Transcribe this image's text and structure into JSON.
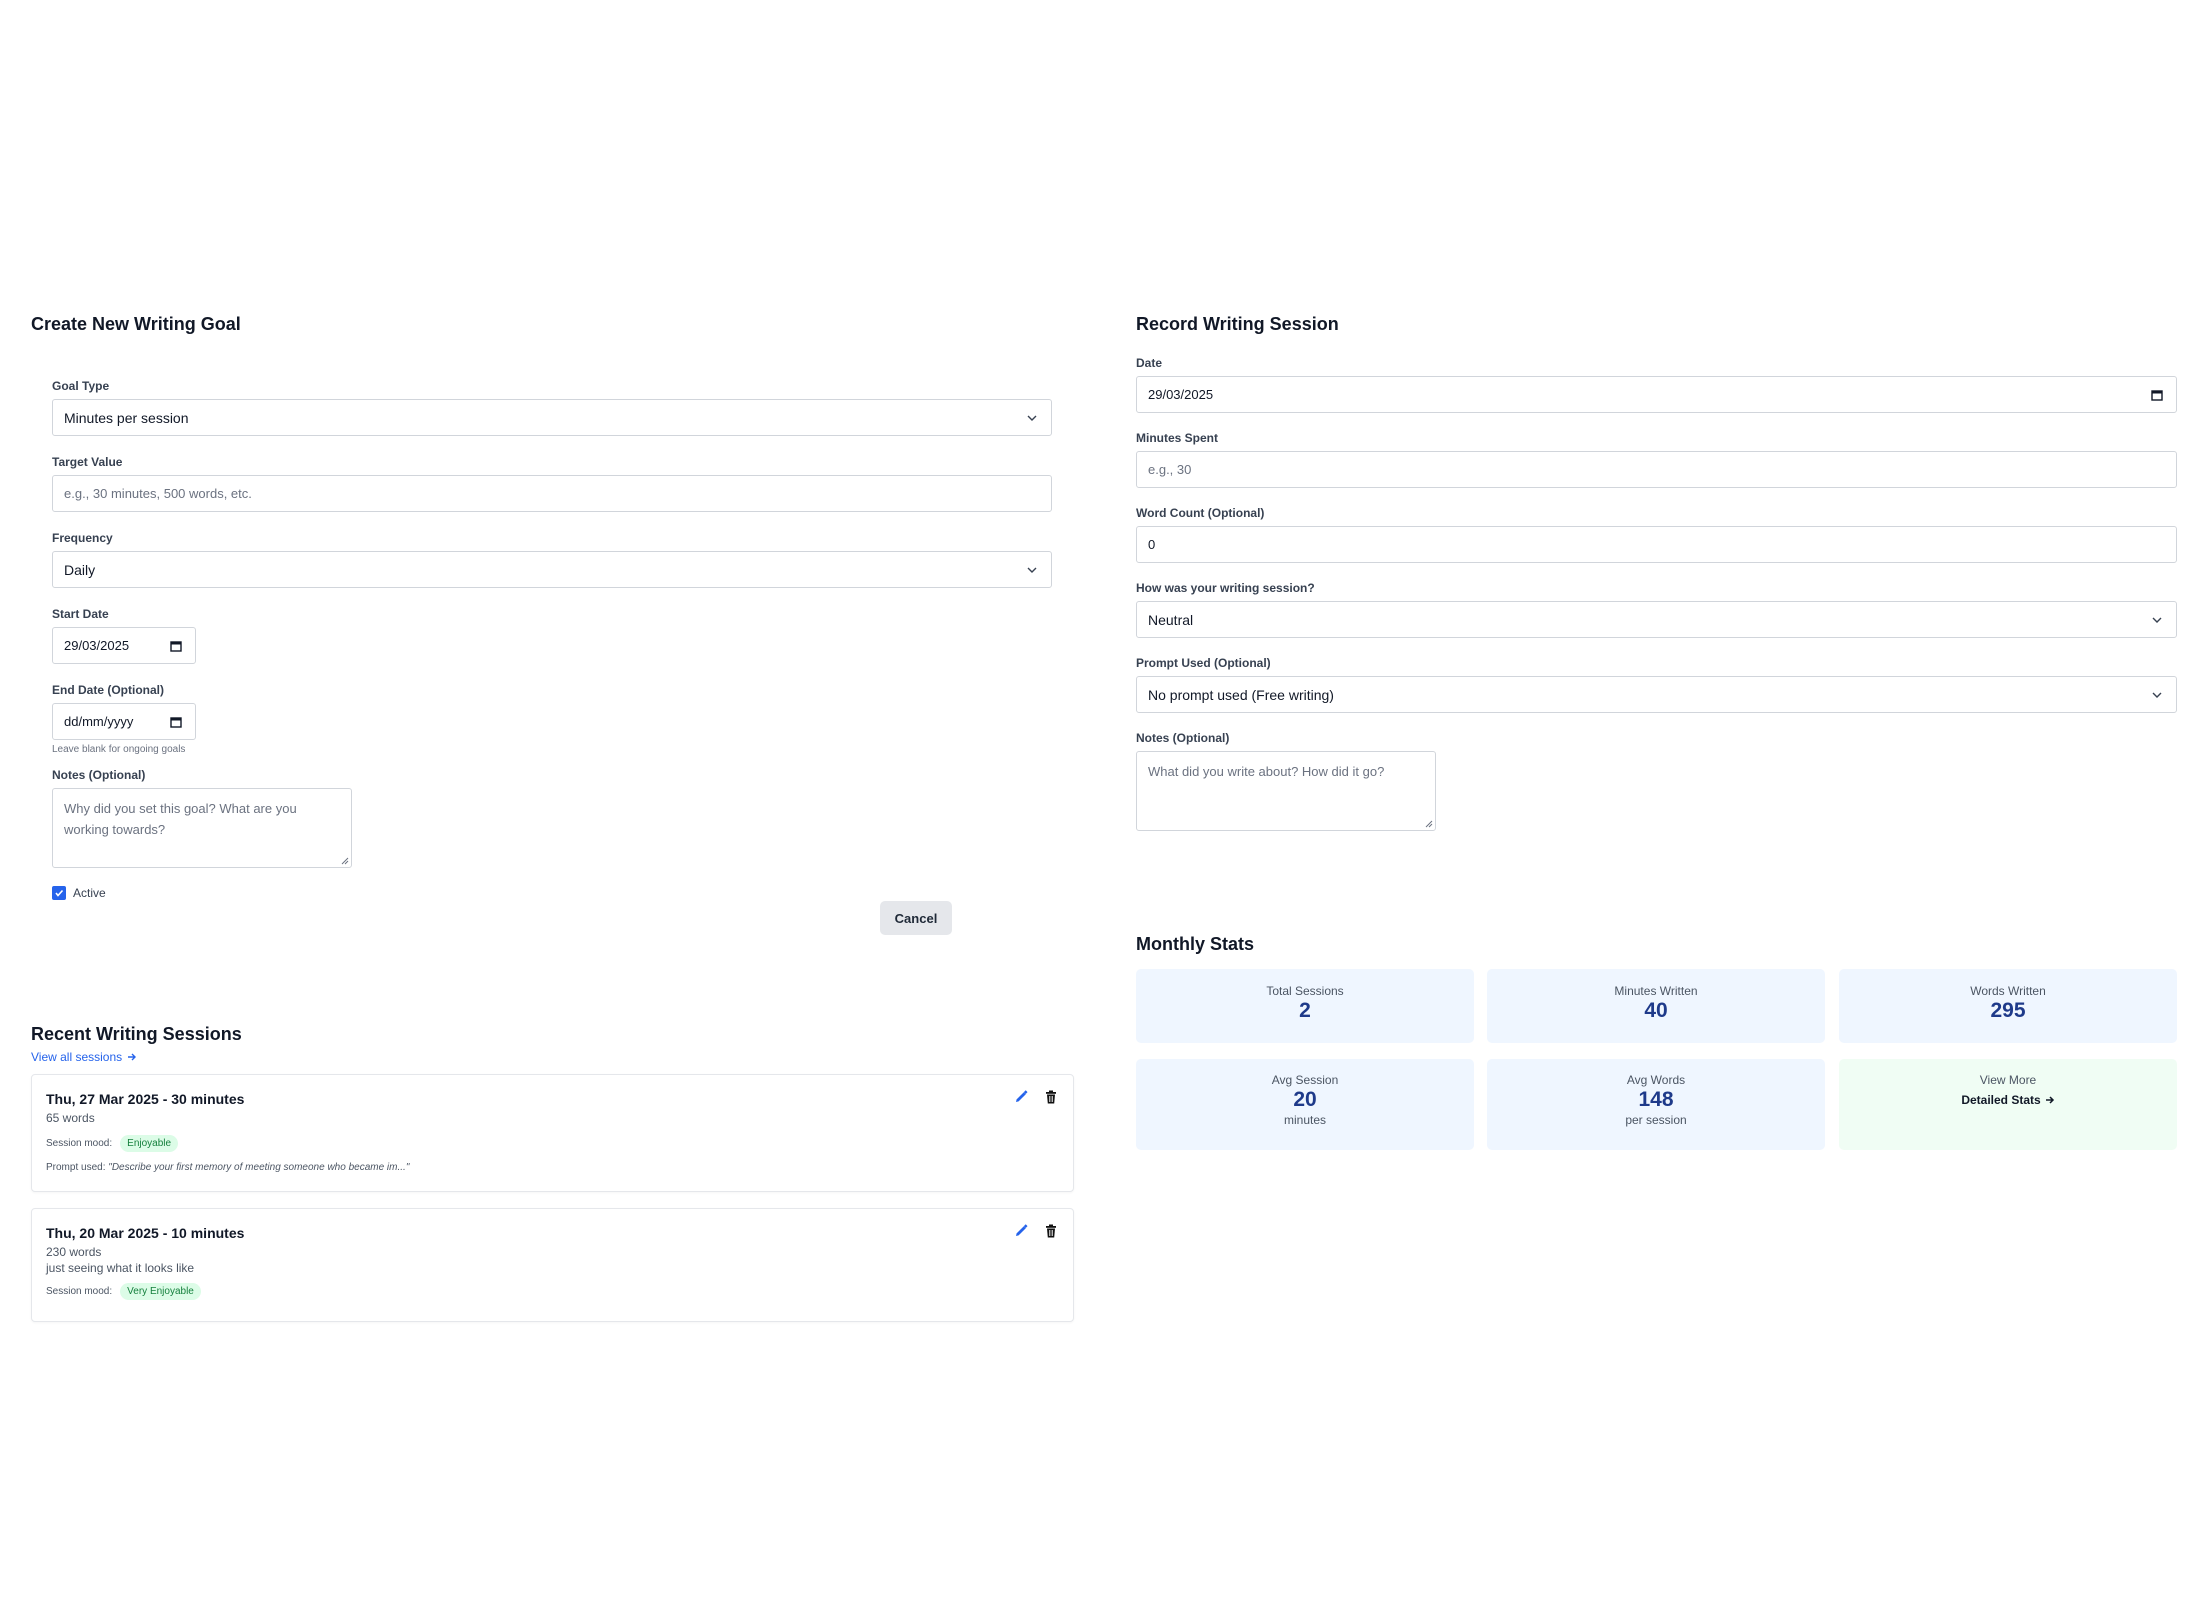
{
  "goal_form": {
    "title": "Create New Writing Goal",
    "goal_type": {
      "label": "Goal Type",
      "value": "Minutes per session"
    },
    "target_value": {
      "label": "Target Value",
      "placeholder": "e.g., 30 minutes, 500 words, etc."
    },
    "frequency": {
      "label": "Frequency",
      "value": "Daily"
    },
    "start_date": {
      "label": "Start Date",
      "value": "29/03/2025"
    },
    "end_date": {
      "label": "End Date (Optional)",
      "value": "dd/mm/yyyy",
      "hint": "Leave blank for ongoing goals"
    },
    "notes": {
      "label": "Notes (Optional)",
      "placeholder_line1": "Why did you set this goal? What are you",
      "placeholder_line2": "working towards?"
    },
    "active": {
      "label": "Active",
      "checked": true
    },
    "cancel_label": "Cancel"
  },
  "recent_sessions": {
    "title": "Recent Writing Sessions",
    "view_all_label": "View all sessions",
    "mood_label": "Session mood:",
    "prompt_label": "Prompt used:",
    "items": [
      {
        "title": "Thu, 27 Mar 2025 - 30 minutes",
        "words": "65 words",
        "mood": "Enjoyable",
        "prompt": "\"Describe your first memory of meeting someone who became im...\""
      },
      {
        "title": "Thu, 20 Mar 2025 - 10 minutes",
        "words": "230 words",
        "note": "just seeing what it looks like",
        "mood": "Very Enjoyable"
      }
    ]
  },
  "session_form": {
    "title": "Record Writing Session",
    "date": {
      "label": "Date",
      "value": "29/03/2025"
    },
    "minutes": {
      "label": "Minutes Spent",
      "placeholder": "e.g., 30"
    },
    "word_count": {
      "label": "Word Count (Optional)",
      "value": "0"
    },
    "mood": {
      "label": "How was your writing session?",
      "value": "Neutral"
    },
    "prompt": {
      "label": "Prompt Used (Optional)",
      "value": "No prompt used (Free writing)"
    },
    "notes": {
      "label": "Notes (Optional)",
      "placeholder": "What did you write about? How did it go?"
    }
  },
  "monthly_stats": {
    "title": "Monthly Stats",
    "total_sessions": {
      "label": "Total Sessions",
      "value": "2"
    },
    "minutes_written": {
      "label": "Minutes Written",
      "value": "40"
    },
    "words_written": {
      "label": "Words Written",
      "value": "295"
    },
    "avg_session": {
      "label": "Avg Session",
      "value": "20",
      "unit": "minutes"
    },
    "avg_words": {
      "label": "Avg Words",
      "value": "148",
      "unit": "per session"
    },
    "view_more": {
      "label": "View More",
      "link": "Detailed Stats"
    }
  },
  "colors": {
    "accent": "#2563eb",
    "stat_bg": "#eff6ff",
    "stat_value": "#1e3a8a",
    "green_bg": "#f0fdf4",
    "pill_bg": "#dcfce7",
    "pill_text": "#15803d"
  },
  "icons": [
    "chevron-down-icon",
    "calendar-icon",
    "check-icon",
    "arrow-right-icon",
    "pencil-icon",
    "trash-icon",
    "resize-grip-icon"
  ]
}
